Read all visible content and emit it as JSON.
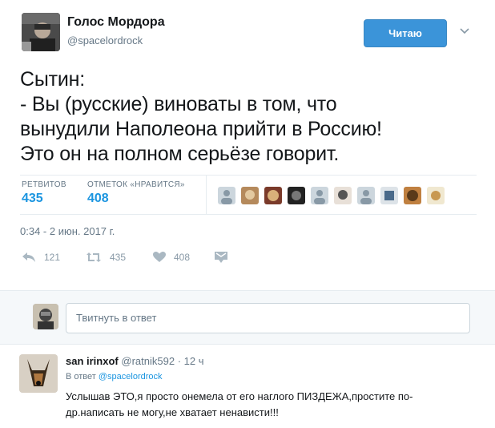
{
  "tweet": {
    "user_name": "Голос Мордора",
    "user_handle": "@spacelordrock",
    "follow_label": "Читаю",
    "text_lines": [
      "Сытин:",
      "- Вы (русские) виноваты в том, что",
      "вынудили Наполеона прийти в Россию!",
      "Это он на полном серьёзе говорит."
    ],
    "retweets_label": "РЕТВИТОВ",
    "retweets_count": "435",
    "likes_label": "ОТМЕТОК «НРАВИТСЯ»",
    "likes_count": "408",
    "timestamp": "0:34 - 2 июн. 2017 г.",
    "actions": {
      "reply_count": "121",
      "retweet_count": "435",
      "like_count": "408"
    }
  },
  "reply_box": {
    "placeholder": "Твитнуть в ответ"
  },
  "reply": {
    "user_name": "san irinxof",
    "user_handle": "@ratnik592",
    "separator": "·",
    "time": "12 ч",
    "in_reply_prefix": "В ответ",
    "in_reply_handle": "@spacelordrock",
    "text_lines": [
      "Услышав ЭТО,я просто онемела от его наглого ПИЗДЕЖА,простите по-",
      "др.написать не могу,не хватает ненависти!!!"
    ]
  },
  "colors": {
    "link_blue": "#1b95e0",
    "follow_button": "#3b94d9",
    "muted": "#657786",
    "reply_bg": "#f5f8fa"
  },
  "icons": [
    "user-avatar-icon",
    "chevron-down-icon",
    "reply-icon",
    "retweet-icon",
    "heart-icon",
    "direct-message-icon"
  ]
}
